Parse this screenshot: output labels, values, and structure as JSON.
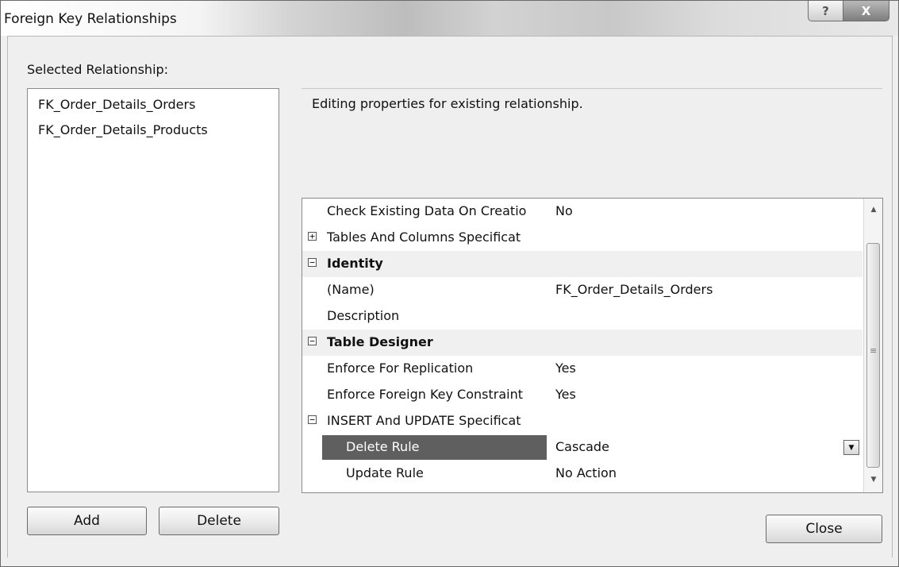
{
  "window": {
    "title": "Foreign Key Relationships",
    "help_glyph": "?",
    "close_glyph": "X"
  },
  "selected_label": "Selected Relationship:",
  "relationships": [
    "FK_Order_Details_Orders",
    "FK_Order_Details_Products"
  ],
  "editing_text": "Editing properties for existing relationship.",
  "properties": [
    {
      "name": "Check Existing Data On Creatio",
      "value": "No",
      "type": "prop"
    },
    {
      "name": "Tables And Columns Specificat",
      "value": "",
      "type": "collapsed",
      "expander": "+"
    },
    {
      "name": "Identity",
      "value": "",
      "type": "section",
      "expander": "−"
    },
    {
      "name": "(Name)",
      "value": "FK_Order_Details_Orders",
      "type": "prop"
    },
    {
      "name": "Description",
      "value": "",
      "type": "prop"
    },
    {
      "name": "Table Designer",
      "value": "",
      "type": "section",
      "expander": "−"
    },
    {
      "name": "Enforce For Replication",
      "value": "Yes",
      "type": "prop"
    },
    {
      "name": "Enforce Foreign Key Constraint",
      "value": "Yes",
      "type": "prop"
    },
    {
      "name": "INSERT And UPDATE Specificat",
      "value": "",
      "type": "expanded",
      "expander": "−"
    },
    {
      "name": "Delete Rule",
      "value": "Cascade",
      "type": "child-selected"
    },
    {
      "name": "Update Rule",
      "value": "No Action",
      "type": "child"
    }
  ],
  "dropdown_icon": "▼",
  "scrollbar": {
    "up_icon": "▲",
    "down_icon": "▼",
    "grip": "≡"
  },
  "buttons": {
    "add": "Add",
    "delete": "Delete",
    "close": "Close"
  }
}
